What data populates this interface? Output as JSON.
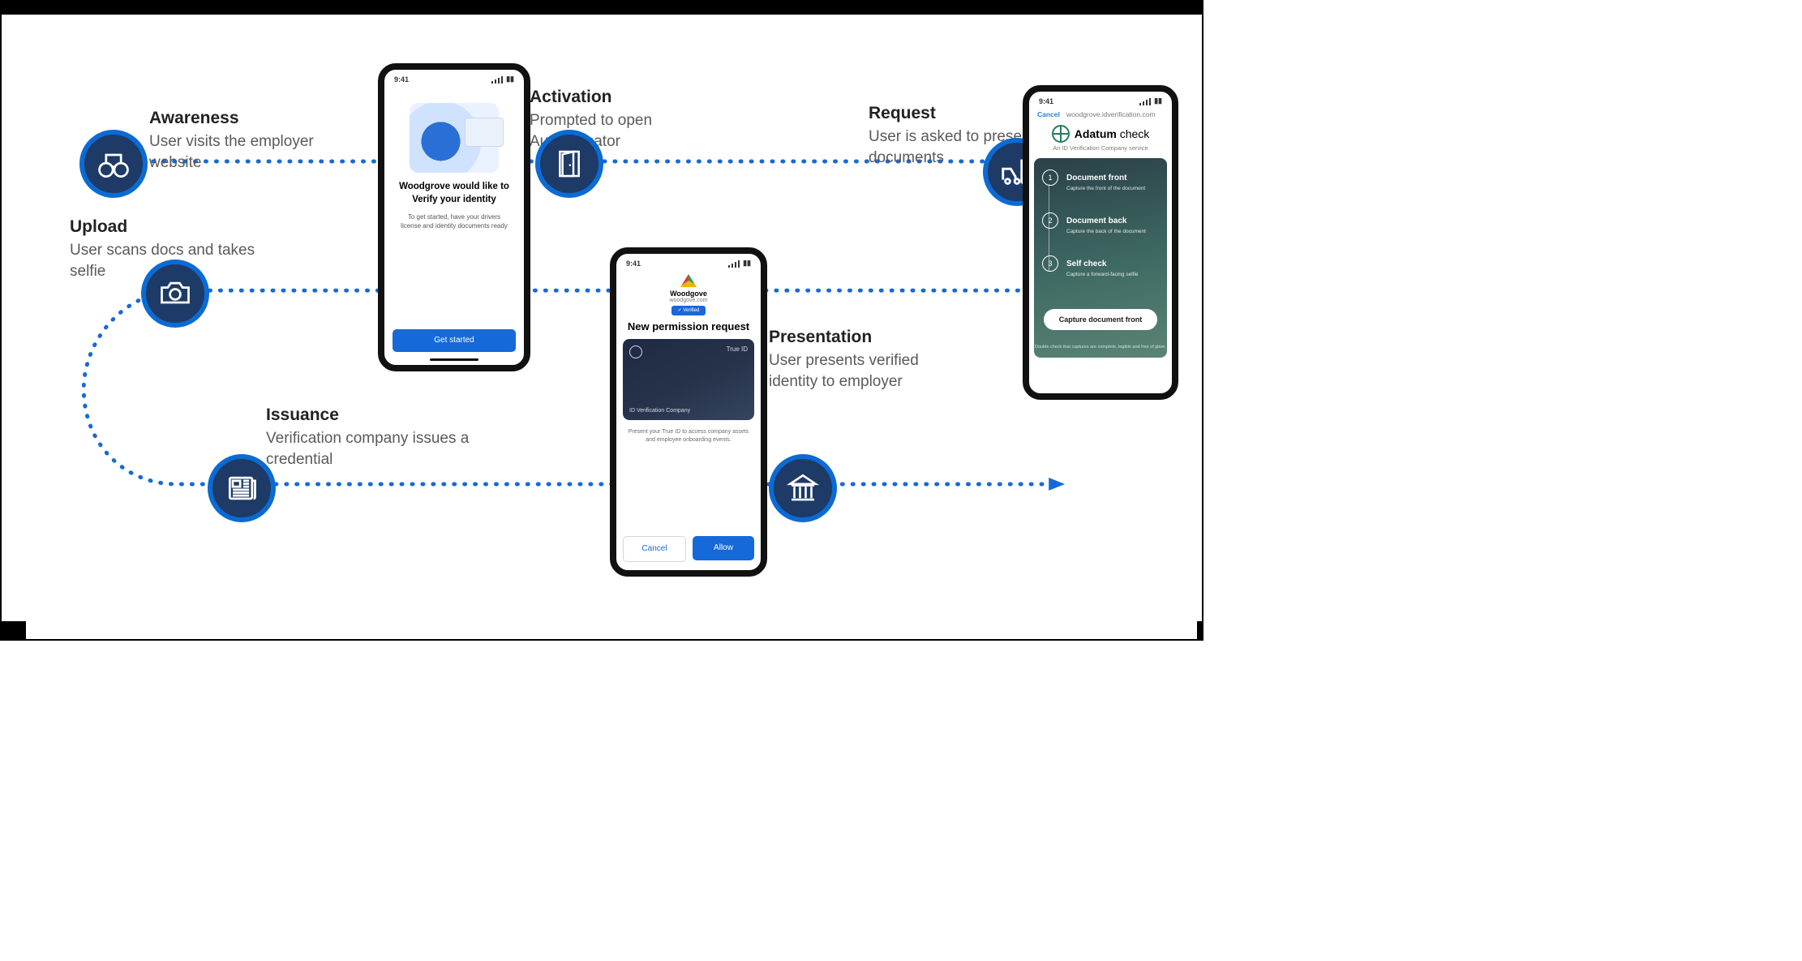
{
  "steps": {
    "awareness": {
      "title": "Awareness",
      "desc": "User visits the employer website"
    },
    "activation": {
      "title": "Activation",
      "desc": "Prompted to open Authenticator"
    },
    "request": {
      "title": "Request",
      "desc": "User is asked to present documents"
    },
    "upload": {
      "title": "Upload",
      "desc": "User scans docs and takes selfie"
    },
    "issuance": {
      "title": "Issuance",
      "desc": "Verification company issues a credential"
    },
    "presentation": {
      "title": "Presentation",
      "desc": "User presents verified identity to employer"
    }
  },
  "phone_status_time": "9:41",
  "phone1": {
    "heading": "Woodgrove would like to Verify your identity",
    "body": "To get started, have your drivers license and identity documents ready",
    "button": "Get started"
  },
  "phone2": {
    "cancel": "Cancel",
    "url": "woodgrove.idverification.com",
    "brand": "Adatum",
    "brand_suffix": "check",
    "subtitle": "An ID Verification Company service",
    "steps": [
      {
        "n": "1",
        "title": "Document front",
        "sub": "Capture the front of the document"
      },
      {
        "n": "2",
        "title": "Document back",
        "sub": "Capture the back of the document"
      },
      {
        "n": "3",
        "title": "Self check",
        "sub": "Capture a forward-facing selfie"
      }
    ],
    "cta": "Capture document front",
    "fineprint": "Double check that captures are complete, legible and free of glare."
  },
  "phone3": {
    "brand": "Woodgove",
    "domain": "woodgove.com",
    "chip": "✓ Verified",
    "heading": "New permission request",
    "card_label": "True ID",
    "card_issuer": "ID Verification Company",
    "body": "Present your True ID to access company assets and employee onboarding events.",
    "cancel": "Cancel",
    "allow": "Allow"
  }
}
